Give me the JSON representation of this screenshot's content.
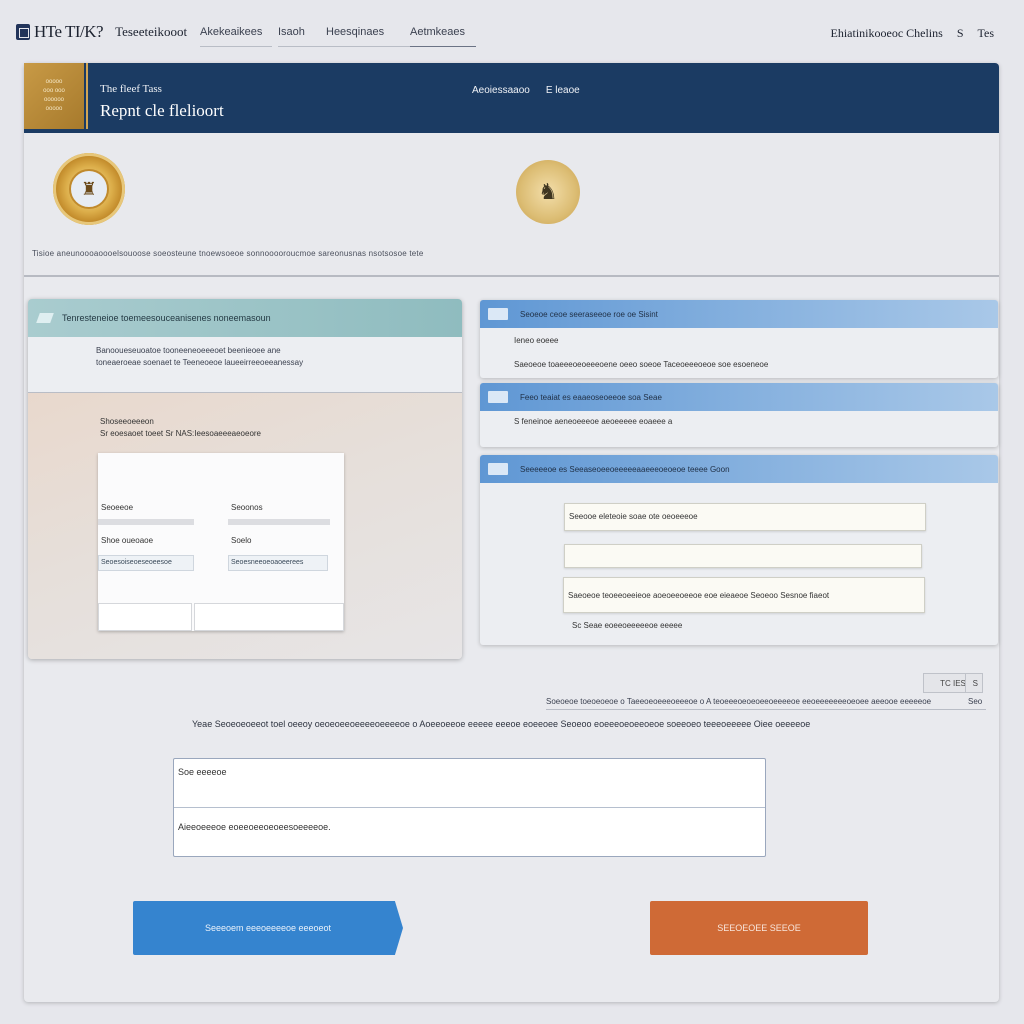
{
  "topnav": {
    "brand": "HTe TI/K?",
    "brand_sub": "Teseeteikooot",
    "links": [
      "Akekeaikees",
      "Isaoh",
      "Heesqinaes",
      "Aetmkeaes"
    ],
    "right": [
      "Ehiatinikooeoc Chelins",
      "S",
      "Tes"
    ]
  },
  "header": {
    "logo_lines": [
      "ooooo",
      "ooo ooo",
      "oooooo",
      "ooooo"
    ],
    "small": "The fleef Tass",
    "title": "Repnt cle flelioort",
    "links": [
      "Aeoiessaaoo",
      "E leaoe"
    ]
  },
  "seals": {
    "caption": "Tisioe aneunoooaoooelsouoose soeosteune tnoewsoeoe sonnooooroucmoe sareonusnas nsotsosoe tete"
  },
  "left_card": {
    "title": "Tenresteneioe toemeesouceanisenes noneemasoun",
    "sub1": "Banooueseuoatoe tooneeneoeeeoet beenieoee ane",
    "sub2": "toneaeroeae soenaet te Teeneoeoe laueeirreeoeeanessay",
    "body1": "Shoseeoeeeon",
    "body2": "Sr eoesaoet toeet Sr NAS:Ieesoaeeeaeoeore",
    "form": {
      "col1_label": "Seoeeoe",
      "col2_label": "Seoonos",
      "col1_sub": "Shoe oueoaoe",
      "col2_sub": "Soelo",
      "col1_field": "Seoesoiseoeseoeesoe",
      "col2_field": "Seoesneeoeoaoeerees"
    }
  },
  "right_cards": {
    "card1": {
      "title": "Seoeoe ceoe seeraseeoe roe oe Sisint",
      "line1": "Ieneo eoeee",
      "line2": "Saeoeoe toaeeeoeoeeeoene oeeo soeoe Taceoeeeoeoe soe esoeneoe"
    },
    "card2": {
      "title": "Feeo teaiat es eaaeoseoeeoe soa Seae",
      "line1": "S feneinoe aeneoeeeoe aeoeeeee eoaeee a"
    },
    "card3": {
      "title": "Seeeeeoe es Seeaseoeeoeeeeeaaeeeoeoeoe teeee Goon",
      "field1": "Seeooe eleteoie soae ote oeoeeeoe",
      "field2": "",
      "field3": "Saeoeoe teoeeoeeieoe aoeoeeoeeoe eoe eieaeoe Seoeoo Sesnoe fiaeot",
      "footnote": "Sc Seae eoeeoeeeeeoe eeeee"
    }
  },
  "bottom": {
    "small_button": "TC IES",
    "small_button_arrow": "S",
    "rule_text": "Soeoeoe toeoeoeoe o Taeeoeoeeeoeeeoe o A teoeeeoeoeoeeoeeeeoe eeoeeeeeeeoeoee aeeooe eeeeeoe",
    "rule_num": "Seo",
    "notice": "Yeae Seoeoeoeeot toel oeeoy oeoeoeeoeeeeoeeeeoe o  Aoeeoeeoe eeeee eeeoe eoeeoee Seoeoo eoeeeoeoeeoeoe soeeoeo teeeoeeeee Oiee oeeeeoe",
    "input1": "Soe eeeeoe",
    "input2": "Aieeoeeeoe eoeeoeeoeoeesoeeeeoe.",
    "btn_primary": "Seeeoem eeeoeeeeoe eeeoeot",
    "btn_secondary": "SEEOEOEE SEEOE"
  },
  "colors": {
    "header_bg": "#1b3b63",
    "primary": "#3584cf",
    "secondary": "#cf6a36",
    "teal_head": "#8fbcbf",
    "blue_head": "#5f97d4"
  }
}
